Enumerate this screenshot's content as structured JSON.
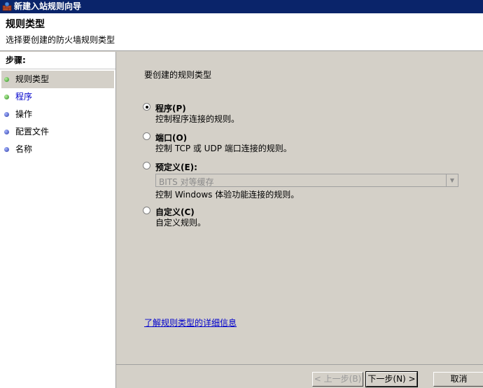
{
  "window": {
    "title": "新建入站规则向导",
    "icon": "firewall-wizard-icon"
  },
  "header": {
    "title": "规则类型",
    "subtitle": "选择要创建的防火墙规则类型"
  },
  "steps": {
    "heading": "步骤:",
    "items": [
      {
        "label": "规则类型",
        "status": "completed",
        "color": "#3a9a2a"
      },
      {
        "label": "程序",
        "status": "completed",
        "color": "#3a9a2a"
      },
      {
        "label": "操作",
        "status": "pending",
        "color": "#2a3aa8"
      },
      {
        "label": "配置文件",
        "status": "pending",
        "color": "#2a3aa8"
      },
      {
        "label": "名称",
        "status": "pending",
        "color": "#2a3aa8"
      }
    ]
  },
  "main": {
    "prompt": "要创建的规则类型",
    "options": [
      {
        "label": "程序(P)",
        "description": "控制程序连接的规则。",
        "checked": true
      },
      {
        "label": "端口(O)",
        "description": "控制 TCP 或 UDP 端口连接的规则。",
        "checked": false
      },
      {
        "label": "预定义(E):",
        "description": "控制 Windows 体验功能连接的规则。",
        "checked": false
      },
      {
        "label": "自定义(C)",
        "description": "自定义规则。",
        "checked": false
      }
    ],
    "predefined_select": {
      "value": "BITS 对等缓存",
      "enabled": false
    },
    "info_link": "了解规则类型的详细信息"
  },
  "buttons": {
    "back": "< 上一步(B)",
    "next": "下一步(N) >",
    "cancel": "取消"
  }
}
